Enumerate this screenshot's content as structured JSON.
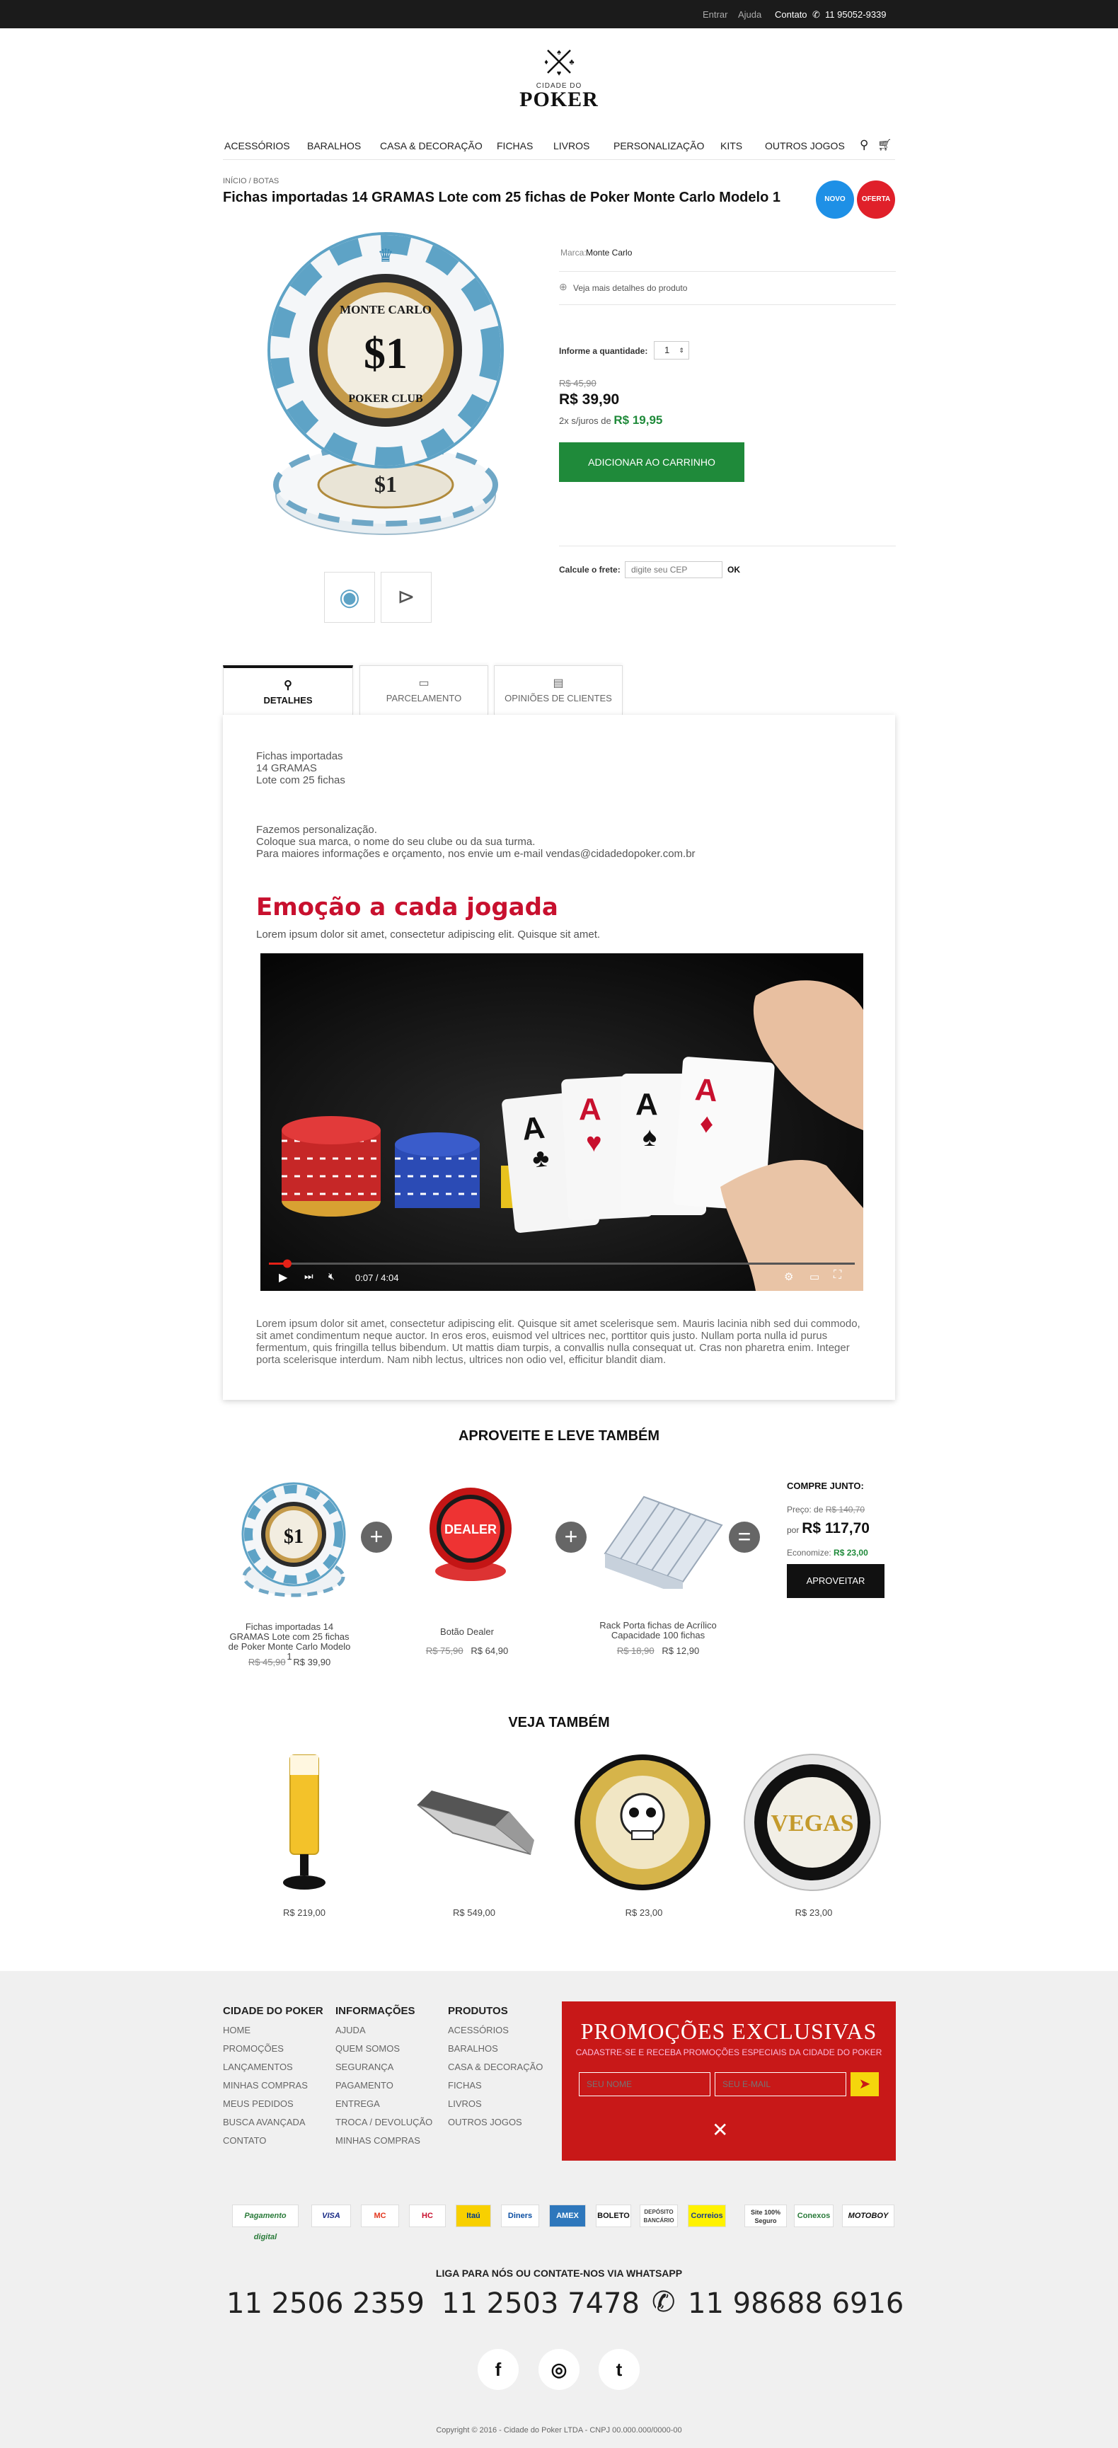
{
  "topbar": {
    "login": "Entrar",
    "help": "Ajuda",
    "contact": "Contato",
    "whatsapp": "11 95052-9339"
  },
  "logo": {
    "sub": "CIDADE DO",
    "main": "POKER"
  },
  "nav": [
    "ACESSÓRIOS",
    "BARALHOS",
    "CASA & DECORAÇÃO",
    "FICHAS",
    "LIVROS",
    "PERSONALIZAÇÃO",
    "KITS",
    "OUTROS JOGOS"
  ],
  "breadcrumb": "INÍCIO / BOTAS",
  "product": {
    "title": "Fichas importadas 14 GRAMAS Lote com 25 fichas de Poker Monte Carlo Modelo 1",
    "badge_new": "NOVO",
    "badge_offer": "OFERTA",
    "brand_label": "Marca:",
    "brand": "Monte Carlo",
    "more_details": "Veja mais detalhes do produto",
    "qty_label": "Informe a quantidade:",
    "qty": "1",
    "old_price": "R$ 45,90",
    "price": "R$ 39,90",
    "installments_prefix": "2x",
    "installments_mid": "s/juros de",
    "installment_value": "R$ 19,95",
    "add_to_cart": "ADICIONAR AO CARRINHO",
    "shipping_label": "Calcule o frete:",
    "cep_placeholder": "digite seu CEP",
    "ok": "OK"
  },
  "tabs": [
    "DETALHES",
    "PARCELAMENTO",
    "OPINIÕES DE CLIENTES"
  ],
  "details": {
    "lines1": [
      "Fichas importadas",
      "14 GRAMAS",
      "Lote com 25 fichas"
    ],
    "lines2": [
      "Fazemos personalização.",
      "Coloque sua marca, o nome do seu clube ou da sua turma.",
      "Para maiores informações e orçamento, nos envie um e-mail vendas@cidadedopoker.com.br"
    ],
    "headline": "Emoção a cada jogada",
    "lead": "Lorem ipsum dolor sit amet, consectetur adipiscing elit. Quisque sit amet.",
    "video_time": "0:07 / 4:04",
    "body": "Lorem ipsum dolor sit amet, consectetur adipiscing elit. Quisque sit amet scelerisque sem. Mauris lacinia nibh sed dui commodo, sit amet condimentum neque auctor. In eros eros, euismod vel ultrices nec, porttitor quis justo. Nullam porta nulla id purus fermentum, quis fringilla tellus bibendum. Ut mattis diam turpis, a convallis nulla consequat ut. Cras non pharetra enim. Integer porta scelerisque interdum. Nam nibh lectus, ultrices non odio vel, efficitur blandit diam."
  },
  "bundle": {
    "title": "APROVEITE E LEVE TAMBÉM",
    "items": [
      {
        "name": "Fichas importadas 14 GRAMAS Lote com 25 fichas de Poker Monte Carlo Modelo 1",
        "old": "R$ 45,90",
        "price": "R$ 39,90"
      },
      {
        "name": "Botão Dealer",
        "old": "R$ 75,90",
        "price": "R$ 64,90"
      },
      {
        "name": "Rack Porta fichas de Acrílico Capacidade 100 fichas",
        "old": "R$ 18,90",
        "price": "R$ 12,90"
      }
    ],
    "buy_together": "COMPRE JUNTO:",
    "price_label": "Preço: de",
    "price_old": "R$ 140,70",
    "por": "por",
    "price_new": "R$ 117,70",
    "savings_label": "Economize:",
    "savings": "R$ 23,00",
    "cta": "APROVEITAR"
  },
  "related": {
    "title": "VEJA TAMBÉM",
    "prices": [
      "R$ 219,00",
      "R$ 549,00",
      "R$ 23,00",
      "R$ 23,00"
    ]
  },
  "footer": {
    "col1": {
      "title": "CIDADE DO POKER",
      "items": [
        "HOME",
        "PROMOÇÕES",
        "LANÇAMENTOS",
        "MINHAS COMPRAS",
        "MEUS PEDIDOS",
        "BUSCA AVANÇADA",
        "CONTATO"
      ]
    },
    "col2": {
      "title": "INFORMAÇÕES",
      "items": [
        "AJUDA",
        "QUEM SOMOS",
        "SEGURANÇA",
        "PAGAMENTO",
        "ENTREGA",
        "TROCA / DEVOLUÇÃO",
        "MINHAS COMPRAS"
      ]
    },
    "col3": {
      "title": "PRODUTOS",
      "items": [
        "ACESSÓRIOS",
        "BARALHOS",
        "CASA & DECORAÇÃO",
        "FICHAS",
        "LIVROS",
        "OUTROS JOGOS"
      ]
    },
    "promo_title": "PROMOÇÕES EXCLUSIVAS",
    "promo_sub": "CADASTRE-SE E RECEBA PROMOÇÕES ESPECIAIS DA CIDADE DO POKER",
    "name_placeholder": "SEU NOME",
    "email_placeholder": "SEU E-MAIL",
    "payments": [
      "Pagamento digital",
      "VISA",
      "MC",
      "HC",
      "Itaú",
      "Diners",
      "AMEX",
      "BOLETO",
      "DEPÓSITO BANCÁRIO",
      "Correios",
      "Site 100% Seguro",
      "Conexos",
      "MOTOBOY"
    ],
    "contact_title": "LIGA PARA NÓS OU CONTATE-NOS VIA WHATSAPP",
    "phone1": "11 2506 2359",
    "phone2": "11 2503 7478",
    "phone3": "11 98688 6916",
    "social": [
      "f",
      "◎",
      "t"
    ],
    "copyright": "Copyright © 2016 - Cidade do Poker LTDA - CNPJ 00.000.000/0000-00"
  }
}
